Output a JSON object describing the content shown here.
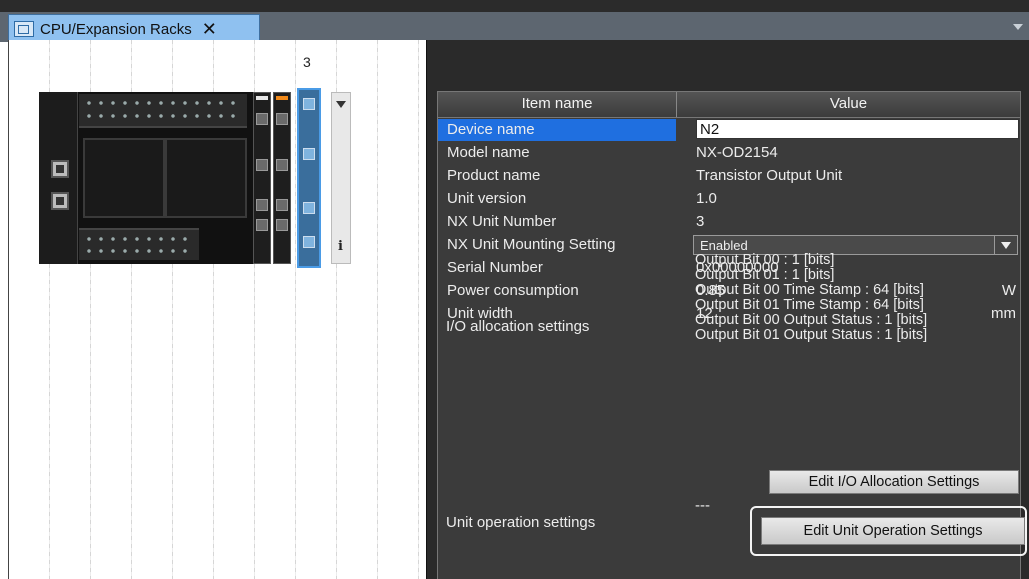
{
  "tab": {
    "title": "CPU/Expansion Racks",
    "close_glyph": "✕",
    "icon": "rack-config-icon"
  },
  "rack": {
    "slot_number": "3",
    "info_glyph": "i"
  },
  "table": {
    "header": {
      "item": "Item name",
      "value": "Value"
    },
    "rows": {
      "device_name": {
        "key": "Device name",
        "value": "N2"
      },
      "model_name": {
        "key": "Model name",
        "value": "NX-OD2154"
      },
      "product_name": {
        "key": "Product name",
        "value": "Transistor Output Unit"
      },
      "unit_version": {
        "key": "Unit version",
        "value": "1.0"
      },
      "nx_unit_number": {
        "key": "NX Unit Number",
        "value": "3"
      },
      "mounting": {
        "key": "NX Unit Mounting Setting",
        "value": "Enabled"
      },
      "serial": {
        "key": "Serial Number",
        "value": "0x00000000"
      },
      "power": {
        "key": "Power consumption",
        "value": "0.85",
        "unit": "W"
      },
      "width": {
        "key": "Unit width",
        "value": "12",
        "unit": "mm"
      }
    },
    "io": {
      "key": "I/O allocation settings",
      "lines": [
        "Output Bit 00 : 1 [bits]",
        "Output Bit 01 : 1 [bits]",
        "Output Bit 00 Time Stamp : 64 [bits]",
        "Output Bit 01 Time Stamp : 64 [bits]",
        "Output Bit 00 Output Status : 1 [bits]",
        "Output Bit 01 Output Status : 1 [bits]"
      ],
      "button": "Edit I/O Allocation Settings"
    },
    "unit_op": {
      "key": "Unit operation settings",
      "value": "---",
      "button": "Edit Unit Operation Settings"
    }
  },
  "colors": {
    "selected_row": "#1f6fe0",
    "tab": "#8fc1f0",
    "panel_bg": "#3b3b3b"
  }
}
